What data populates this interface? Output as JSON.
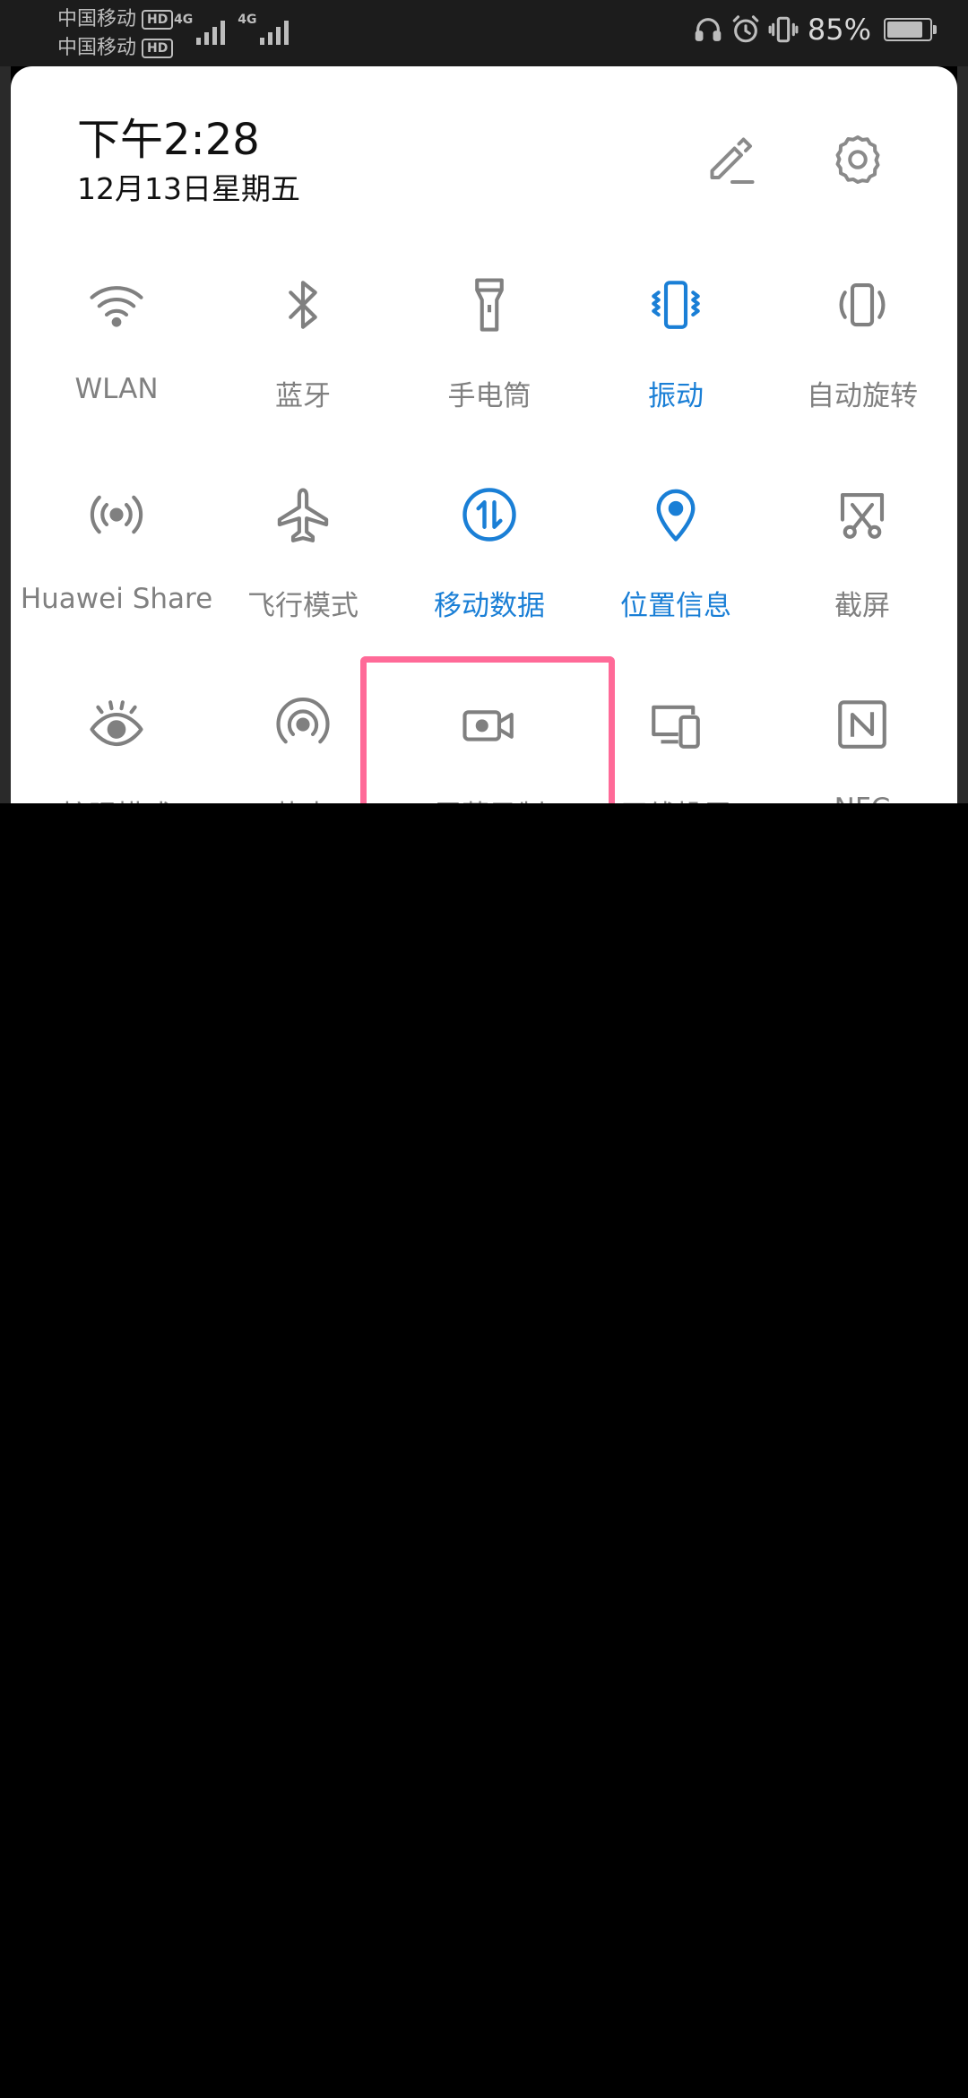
{
  "status_bar": {
    "carrier1": "中国移动",
    "carrier2": "中国移动",
    "hd_label": "HD",
    "network1": "4G",
    "network2": "4G",
    "battery_percent": "85%",
    "battery_level": 0.85,
    "icons": [
      "headset-icon",
      "alarm-icon",
      "vibrate-icon",
      "battery-icon"
    ]
  },
  "header": {
    "time": "下午2:28",
    "date": "12月13日星期五",
    "edit_icon": "pencil-icon",
    "settings_icon": "gear-icon"
  },
  "tiles": [
    {
      "label": "WLAN",
      "icon": "wifi-icon",
      "active": false
    },
    {
      "label": "蓝牙",
      "icon": "bluetooth-icon",
      "active": false
    },
    {
      "label": "手电筒",
      "icon": "flashlight-icon",
      "active": false
    },
    {
      "label": "振动",
      "icon": "vibrate-icon",
      "active": true
    },
    {
      "label": "自动旋转",
      "icon": "auto-rotate-icon",
      "active": false
    },
    {
      "label": "Huawei Share",
      "icon": "huawei-share-icon",
      "active": false
    },
    {
      "label": "飞行模式",
      "icon": "airplane-icon",
      "active": false
    },
    {
      "label": "移动数据",
      "icon": "mobile-data-icon",
      "active": true
    },
    {
      "label": "位置信息",
      "icon": "location-icon",
      "active": true
    },
    {
      "label": "截屏",
      "icon": "screenshot-icon",
      "active": false
    },
    {
      "label": "护眼模式",
      "icon": "eye-comfort-icon",
      "active": false
    },
    {
      "label": "热点",
      "icon": "hotspot-icon",
      "active": false
    },
    {
      "label": "屏幕录制",
      "icon": "screen-record-icon",
      "active": false
    },
    {
      "label": "无线投屏",
      "icon": "wireless-projection-icon",
      "active": false
    },
    {
      "label": "NFC",
      "icon": "nfc-icon",
      "active": false
    }
  ],
  "colors": {
    "active": "#1a7fd6",
    "inactive": "#808080",
    "highlight": "#ff6a98"
  }
}
